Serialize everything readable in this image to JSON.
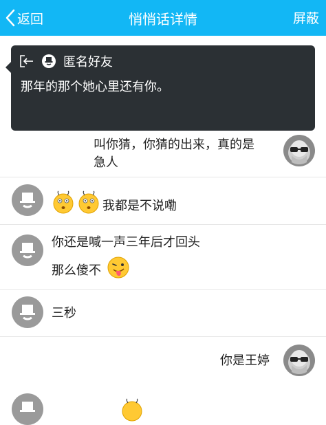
{
  "header": {
    "back_label": "返回",
    "title": "悄悄话详情",
    "action_label": "屏蔽"
  },
  "popup": {
    "sender": "匿名好友",
    "message": "那年的那个她心里还有你。"
  },
  "messages": [
    {
      "text_line1": "叫你猜，你猜的出来，真的是",
      "text_line2": "急人"
    },
    {
      "text": "我都是不说嘞"
    },
    {
      "text_line1": "你还是喊一声三年后才回头",
      "text_line2": "那么傻不"
    },
    {
      "text": "三秒"
    },
    {
      "text": "你是王婷"
    }
  ],
  "icons": {
    "back": "chevron-left-icon",
    "exit": "exit-arrow-icon",
    "anon": "anonymous-user-icon",
    "emoji_shy": "shy-face-emoji",
    "emoji_tongue": "tongue-out-emoji"
  }
}
